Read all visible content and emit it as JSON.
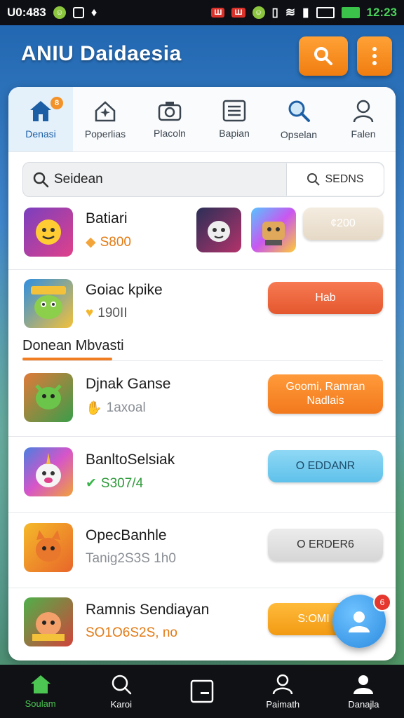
{
  "status_bar": {
    "left_text": "U0:483",
    "badge_a": "Ш",
    "badge_b": "Ш",
    "time": "12:23"
  },
  "app": {
    "title": "ANIU Daidaesia"
  },
  "tabs": [
    {
      "label": "Denasi",
      "icon": "home-icon",
      "badge": "8",
      "active": true
    },
    {
      "label": "Poperlias",
      "icon": "sparkle-house-icon"
    },
    {
      "label": "Placoln",
      "icon": "camera-icon"
    },
    {
      "label": "Bapian",
      "icon": "list-icon"
    },
    {
      "label": "Opselan",
      "icon": "magnifier-icon"
    },
    {
      "label": "Falen",
      "icon": "user-icon"
    }
  ],
  "search": {
    "value": "Seidean",
    "button_label": "SEDNS"
  },
  "rows": [
    {
      "title": "Batiari",
      "sub": "S800",
      "action": "¢200"
    },
    {
      "title": "Goiac kpike",
      "sub": "190II",
      "action": "Hab"
    },
    {
      "title": "Djnak Ganse",
      "sub": "1axoal",
      "action": "Goomi, Ramran Nadlais"
    },
    {
      "title": "BanltoSelsiak",
      "sub": "S307/4",
      "action": "O EDDANR"
    },
    {
      "title": "OpecBanhle",
      "sub": "Tanig2S3S 1h0",
      "action": "O ERDER6"
    },
    {
      "title": "Ramnis Sendiayan",
      "sub": "SO1O6S2S, no",
      "action": "S:OMI"
    }
  ],
  "section": {
    "title": "Donean Mbvasti"
  },
  "fab": {
    "badge": "6"
  },
  "bottom_nav": [
    {
      "label": "Soulam",
      "icon": "home-icon",
      "active": true
    },
    {
      "label": "Karoi",
      "icon": "search-icon"
    },
    {
      "label": "",
      "icon": "card-icon"
    },
    {
      "label": "Paimath",
      "icon": "person-icon"
    },
    {
      "label": "Danajla",
      "icon": "people-icon"
    }
  ],
  "colors": {
    "accent_orange": "#f28a22",
    "accent_blue": "#1d5fa5",
    "nav_active": "#4cc552"
  }
}
